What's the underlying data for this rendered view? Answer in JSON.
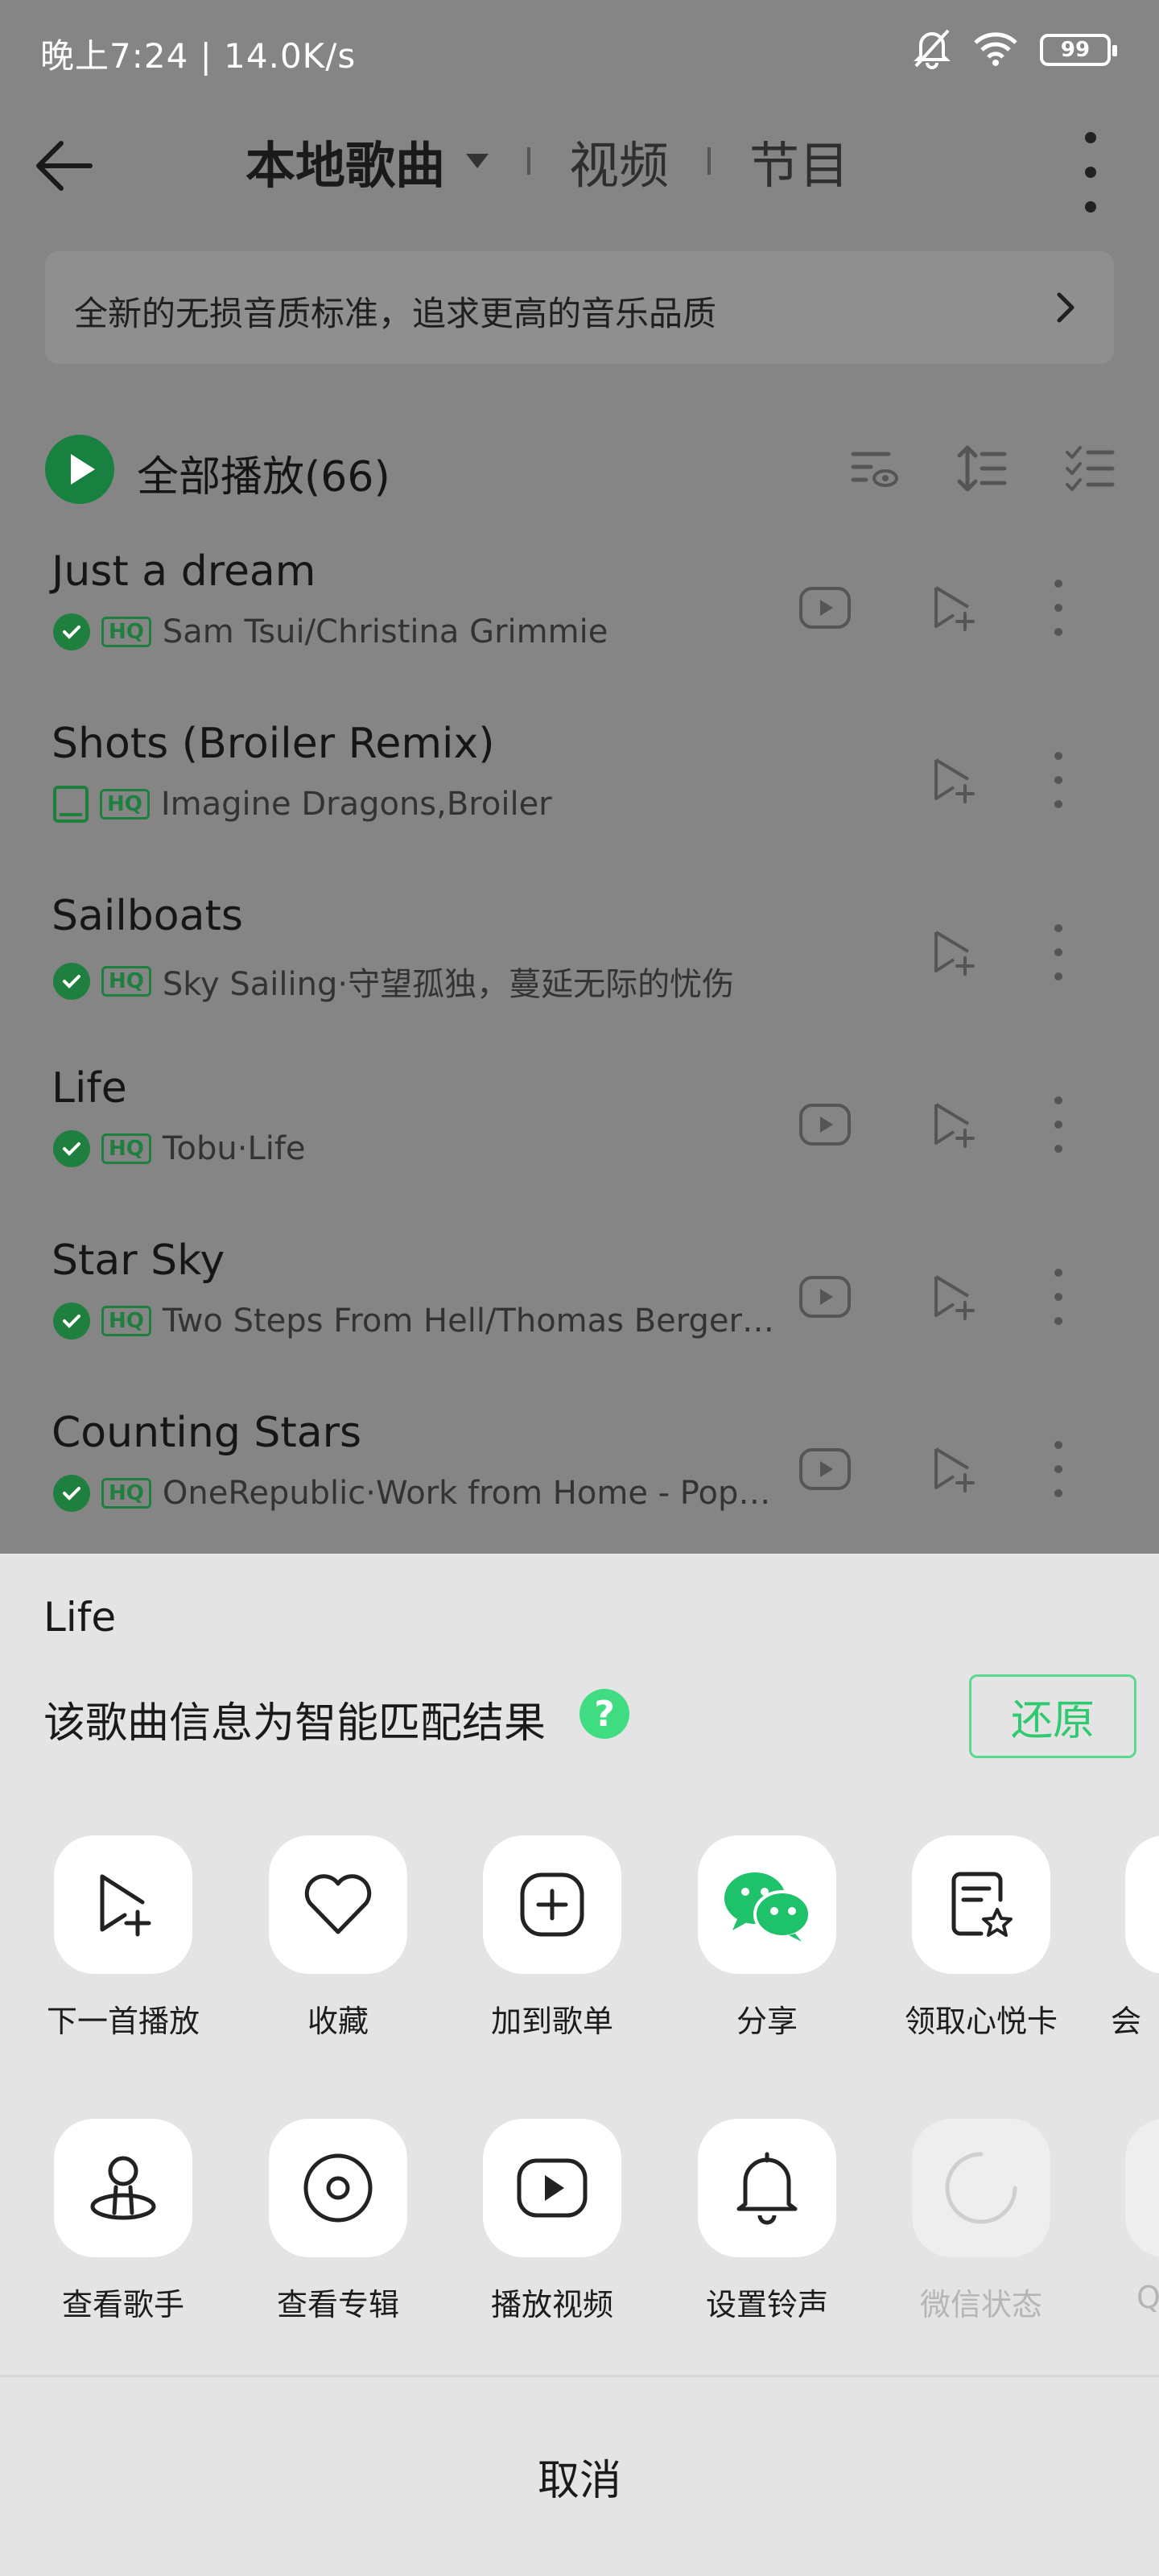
{
  "status": {
    "text": "晚上7:24 | 14.0K/s",
    "battery": "99"
  },
  "header": {
    "tab_active": "本地歌曲",
    "tab_video": "视频",
    "tab_program": "节目"
  },
  "banner": {
    "text": "全新的无损音质标准，追求更高的音乐品质"
  },
  "list": {
    "play_all": "全部播放(66)",
    "hq_label": "HQ",
    "songs": [
      {
        "title": "Just a dream",
        "meta": "Sam Tsui/Christina Grimmie"
      },
      {
        "title": "Shots (Broiler Remix)",
        "meta": "Imagine Dragons,Broiler"
      },
      {
        "title": "Sailboats",
        "meta": "Sky Sailing·守望孤独，蔓延无际的忧伤"
      },
      {
        "title": "Life",
        "meta": "Tobu·Life"
      },
      {
        "title": "Star Sky",
        "meta": "Two Steps From Hell/Thomas Berger…"
      },
      {
        "title": "Counting Stars",
        "meta": "OneRepublic·Work from Home - Pop…"
      }
    ]
  },
  "sheet": {
    "song_title": "Life",
    "match_text": "该歌曲信息为智能匹配结果",
    "help_glyph": "?",
    "restore_label": "还原",
    "row1": [
      {
        "label": "下一首播放",
        "icon": "next-play-icon"
      },
      {
        "label": "收藏",
        "icon": "heart-icon"
      },
      {
        "label": "加到歌单",
        "icon": "add-to-playlist-icon"
      },
      {
        "label": "分享",
        "icon": "wechat-icon"
      },
      {
        "label": "领取心悦卡",
        "icon": "card-star-icon"
      },
      {
        "label": "会",
        "icon": "partial-icon"
      }
    ],
    "row2": [
      {
        "label": "查看歌手",
        "icon": "singer-icon"
      },
      {
        "label": "查看专辑",
        "icon": "album-icon"
      },
      {
        "label": "播放视频",
        "icon": "play-video-icon"
      },
      {
        "label": "设置铃声",
        "icon": "bell-icon"
      },
      {
        "label": "微信状态",
        "icon": "wechat-status-icon"
      },
      {
        "label": "Q",
        "icon": "partial-icon"
      }
    ],
    "cancel_label": "取消"
  },
  "colors": {
    "accent_green": "#2fc970",
    "dim_overlay": "#858585",
    "sheet_bg": "#e4e4e4"
  }
}
